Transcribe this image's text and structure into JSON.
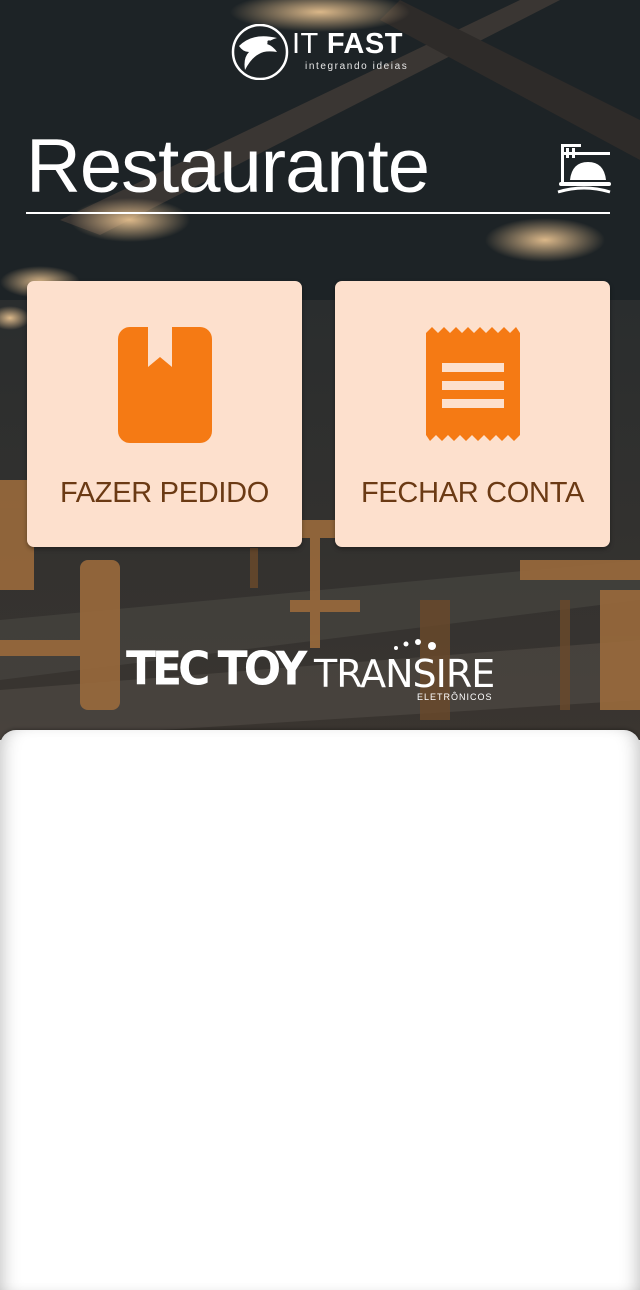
{
  "header": {
    "logo_brand": "IT",
    "logo_brand_bold": "FAST",
    "logo_tagline": "integrando ideias"
  },
  "page": {
    "title": "Restaurante"
  },
  "actions": {
    "order_label": "FAZER PEDIDO",
    "bill_label": "FECHAR CONTA"
  },
  "partners": {
    "tectoy": "TEC TOY",
    "transire": "TRANSIRE",
    "transire_sub": "ELETRÔNICOS"
  },
  "icons": {
    "header": "waiter-cloche-icon",
    "order": "bookmark-book-icon",
    "bill": "receipt-icon"
  },
  "colors": {
    "card_bg": "#fde0cd",
    "accent": "#f57a14",
    "label": "#6b3a14"
  }
}
